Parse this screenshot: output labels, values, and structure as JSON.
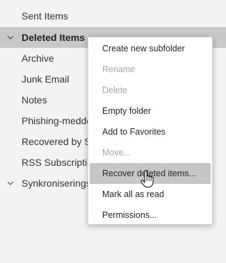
{
  "folders": [
    {
      "label": "Sent Items"
    },
    {
      "label": "Deleted Items"
    },
    {
      "label": "Archive"
    },
    {
      "label": "Junk Email"
    },
    {
      "label": "Notes"
    },
    {
      "label": "Phishing-meddelanden"
    },
    {
      "label": "Recovered by Se"
    },
    {
      "label": "RSS Subscriptions"
    },
    {
      "label": "Synkroniseringsproblem"
    }
  ],
  "context_menu": {
    "items": [
      {
        "label": "Create new subfolder",
        "enabled": true
      },
      {
        "label": "Rename",
        "enabled": false
      },
      {
        "label": "Delete",
        "enabled": false
      },
      {
        "label": "Empty folder",
        "enabled": true
      },
      {
        "label": "Add to Favorites",
        "enabled": true
      },
      {
        "label": "Move...",
        "enabled": false
      },
      {
        "label": "Recover deleted items...",
        "enabled": true,
        "hovered": true
      },
      {
        "label": "Mark all as read",
        "enabled": true
      },
      {
        "label": "Permissions...",
        "enabled": true
      }
    ]
  },
  "icons": {
    "deleted_items_chevron": "chevron-down-icon",
    "sync_issues_chevron": "chevron-down-icon",
    "cursor": "hand-pointer-icon"
  },
  "colors": {
    "pane_background": "#f3f3f3",
    "selected_row": "#c8c8c8",
    "menu_background": "#ffffff",
    "menu_hover": "#c6c6c6",
    "text": "#333333",
    "disabled_text": "#a6a6a6"
  }
}
